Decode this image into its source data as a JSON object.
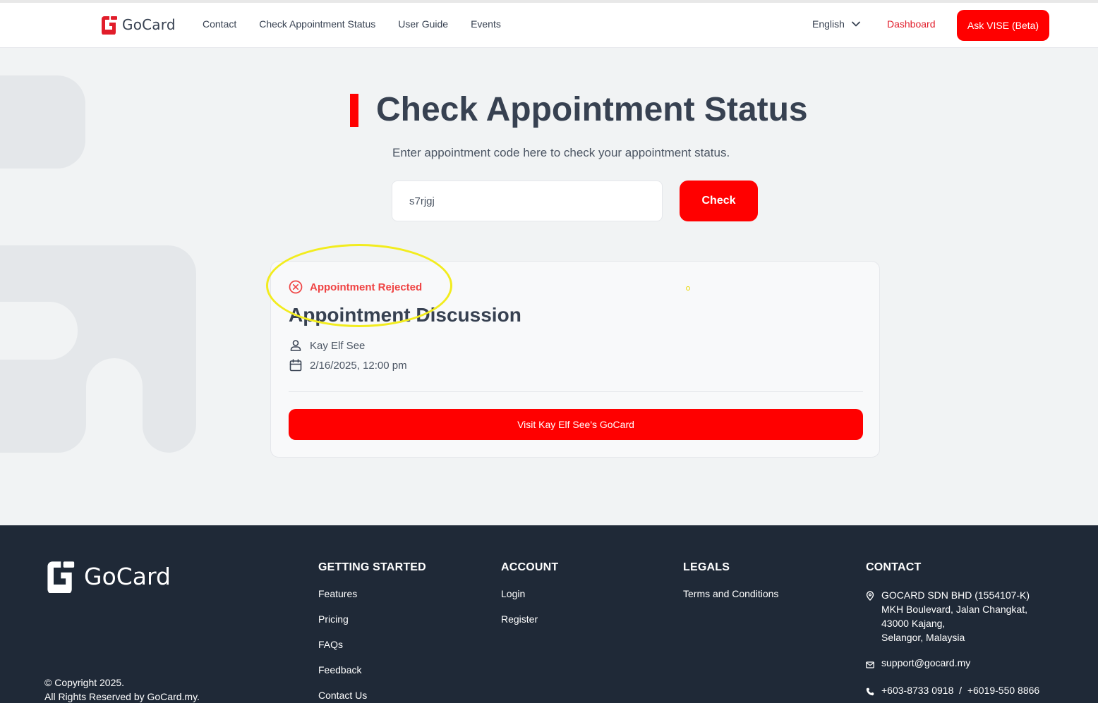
{
  "header": {
    "brand": "GoCard",
    "nav": [
      "Contact",
      "Check Appointment Status",
      "User Guide",
      "Events"
    ],
    "language": "English",
    "dashboard": "Dashboard",
    "ask_button": "Ask VISE (Beta)"
  },
  "main": {
    "title": "Check Appointment Status",
    "subtitle": "Enter appointment code here to check your appointment status.",
    "code_value": "s7rjgj",
    "check_button": "Check",
    "card": {
      "status": "Appointment Rejected",
      "title": "Appointment Discussion",
      "person": "Kay Elf See",
      "datetime": "2/16/2025, 12:00 pm",
      "visit_button": "Visit Kay Elf See's GoCard"
    }
  },
  "footer": {
    "brand": "GoCard",
    "copyright_line1": "© Copyright 2025.",
    "copyright_line2": "All Rights Reserved by GoCard.my.",
    "getting_started": {
      "heading": "GETTING STARTED",
      "links": [
        "Features",
        "Pricing",
        "FAQs",
        "Feedback",
        "Contact Us"
      ]
    },
    "account": {
      "heading": "ACCOUNT",
      "links": [
        "Login",
        "Register"
      ]
    },
    "legals": {
      "heading": "LEGALS",
      "links": [
        "Terms and Conditions"
      ]
    },
    "contact": {
      "heading": "CONTACT",
      "address": [
        "GOCARD SDN BHD (1554107-K)",
        "MKH Boulevard, Jalan Changkat,",
        "43000 Kajang,",
        "Selangor, Malaysia"
      ],
      "email": "support@gocard.my",
      "phone": "+603-8733 0918  /  +6019-550 8866"
    }
  },
  "colors": {
    "brand_red": "#ff0000",
    "status_red": "#ef4444",
    "footer_bg": "#1f2937",
    "annotation_yellow": "#f2ec1e"
  }
}
